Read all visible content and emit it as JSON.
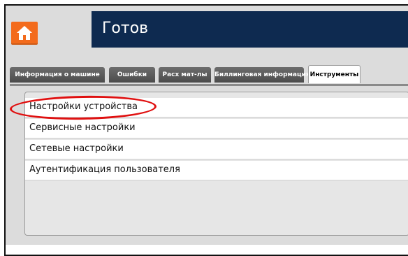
{
  "header": {
    "title": "Готов"
  },
  "home": {
    "icon": "home-icon"
  },
  "tabs": [
    {
      "label": "Информация о машине",
      "active": false
    },
    {
      "label": "Ошибки",
      "active": false
    },
    {
      "label": "Расх мат-лы",
      "active": false
    },
    {
      "label": "Биллинговая информация",
      "active": false
    },
    {
      "label": "Инструменты",
      "active": true
    }
  ],
  "menu": {
    "items": [
      {
        "label": "Настройки устройства"
      },
      {
        "label": "Сервисные настройки"
      },
      {
        "label": "Сетевые настройки"
      },
      {
        "label": "Аутентификация пользователя"
      }
    ]
  },
  "colors": {
    "header_bg": "#0e2a50",
    "home_button": "#f36b1c",
    "highlight": "#e01010",
    "tab_inactive": "#5a5a5a"
  }
}
